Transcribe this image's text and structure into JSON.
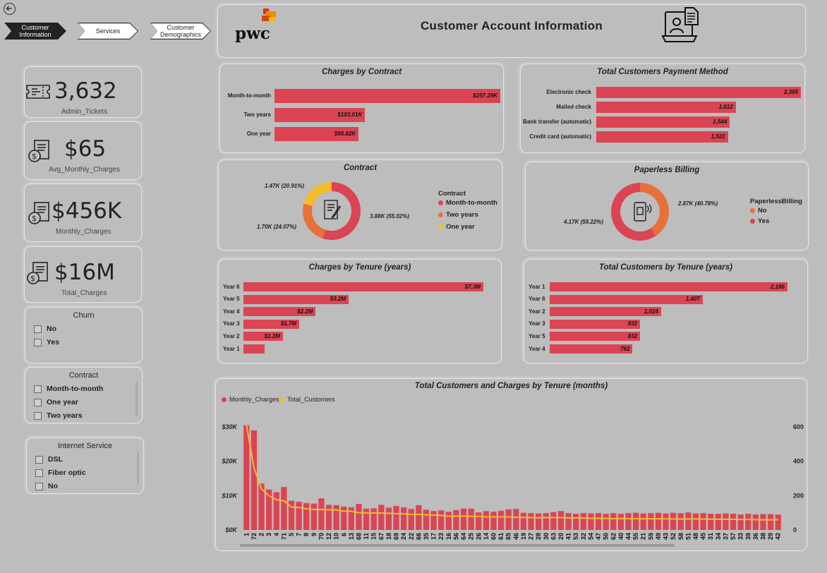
{
  "nav": {
    "tabs": [
      {
        "label_line1": "Customer",
        "label_line2": "Information"
      },
      {
        "label_line1": "Services",
        "label_line2": ""
      },
      {
        "label_line1": "Customer",
        "label_line2": "Demographics"
      }
    ]
  },
  "header": {
    "logo_text": "pwc",
    "title": "Customer Account Information"
  },
  "kpis": [
    {
      "value": "3,632",
      "label": "Admin_Tickets",
      "icon": "ticket-icon"
    },
    {
      "value": "$65",
      "label": "Avg_Monthly_Charges",
      "icon": "invoice-dollar-icon"
    },
    {
      "value": "$456K",
      "label": "Monthly_Charges",
      "icon": "invoice-dollar-icon"
    },
    {
      "value": "$16M",
      "label": "Total_Charges",
      "icon": "invoice-dollar-icon"
    }
  ],
  "slicers": {
    "churn": {
      "title": "Churn",
      "options": [
        "No",
        "Yes"
      ]
    },
    "contract": {
      "title": "Contract",
      "options": [
        "Month-to-month",
        "One year",
        "Two years"
      ]
    },
    "internet": {
      "title": "Internet Service",
      "options": [
        "DSL",
        "Fiber optic",
        "No"
      ]
    }
  },
  "colors": {
    "accent": "#db4453",
    "orange": "#e8703a",
    "yellow": "#f5bc29",
    "background": "#bdbdbd"
  },
  "charts": {
    "charges_by_contract": {
      "title": "Charges by Contract",
      "chart_data": {
        "type": "bar",
        "categories": [
          "Month-to-month",
          "Two years",
          "One year"
        ],
        "values": [
          257.29,
          103.01,
          95.82
        ],
        "value_labels": [
          "$257.29K",
          "$103.01K",
          "$95.82K"
        ],
        "unit": "K"
      }
    },
    "payment_method": {
      "title": "Total Customers Payment Method",
      "chart_data": {
        "type": "bar",
        "categories": [
          "Electronic check",
          "Mailed check",
          "Bank transfer (automatic)",
          "Credit card (automatic)"
        ],
        "values": [
          2365,
          1612,
          1544,
          1522
        ],
        "value_labels": [
          "2,365",
          "1,612",
          "1,544",
          "1,522"
        ]
      }
    },
    "contract_donut": {
      "title": "Contract",
      "legend_title": "Contract",
      "chart_data": {
        "type": "pie",
        "categories": [
          "Month-to-month",
          "Two years",
          "One year"
        ],
        "values": [
          55.02,
          24.07,
          20.91
        ],
        "value_labels": [
          "3.88K (55.02%)",
          "1.70K (24.07%)",
          "1.47K (20.91%)"
        ]
      }
    },
    "paperless_donut": {
      "title": "Paperless Billing",
      "legend_title": "PaperlessBilling",
      "chart_data": {
        "type": "pie",
        "categories": [
          "No",
          "Yes"
        ],
        "values": [
          40.78,
          59.22
        ],
        "value_labels": [
          "2.87K (40.78%)",
          "4.17K (59.22%)"
        ]
      }
    },
    "charges_by_tenure": {
      "title": "Charges by Tenure (years)",
      "chart_data": {
        "type": "bar",
        "categories": [
          "Year 6",
          "Year 5",
          "Year 4",
          "Year 3",
          "Year 2",
          "Year 1"
        ],
        "values": [
          7.3,
          3.2,
          2.2,
          1.7,
          1.2,
          0.65
        ],
        "value_labels": [
          "$7.3M",
          "$3.2M",
          "$2.2M",
          "$1.7M",
          "$1.2M",
          ""
        ],
        "unit": "M"
      }
    },
    "customers_by_tenure": {
      "title": "Total Customers by Tenure (years)",
      "chart_data": {
        "type": "bar",
        "categories": [
          "Year 1",
          "Year 6",
          "Year 2",
          "Year 3",
          "Year 5",
          "Year 4"
        ],
        "values": [
          2186,
          1407,
          1024,
          832,
          832,
          762
        ],
        "value_labels": [
          "2,186",
          "1,407",
          "1,024",
          "832",
          "832",
          "762"
        ]
      }
    },
    "tenure_months": {
      "title": "Total Customers and Charges by Tenure (months)",
      "chart_data": {
        "type": "bar",
        "categories": [
          "1",
          "72",
          "2",
          "3",
          "4",
          "71",
          "5",
          "7",
          "8",
          "9",
          "70",
          "12",
          "10",
          "6",
          "13",
          "68",
          "11",
          "15",
          "67",
          "18",
          "69",
          "24",
          "22",
          "66",
          "35",
          "17",
          "23",
          "16",
          "56",
          "64",
          "25",
          "26",
          "14",
          "60",
          "61",
          "65",
          "46",
          "19",
          "27",
          "28",
          "30",
          "63",
          "20",
          "41",
          "53",
          "32",
          "54",
          "47",
          "50",
          "62",
          "40",
          "44",
          "55",
          "21",
          "59",
          "49",
          "43",
          "52",
          "58",
          "51",
          "48",
          "45",
          "31",
          "34",
          "37",
          "57",
          "33",
          "39",
          "36",
          "38",
          "29",
          "42"
        ],
        "series": [
          {
            "name": "Monthly_Charges",
            "axis": "left",
            "values": [
              30500,
              29000,
              13500,
              11800,
              11000,
              12500,
              8500,
              8200,
              7800,
              7700,
              9200,
              7300,
              7200,
              6800,
              6600,
              7600,
              6200,
              6300,
              7300,
              6500,
              7000,
              6600,
              6100,
              7200,
              5900,
              5500,
              5700,
              5300,
              5800,
              6200,
              6200,
              5100,
              5500,
              5300,
              5600,
              6000,
              6100,
              5000,
              4900,
              4800,
              4900,
              5200,
              5500,
              4900,
              4700,
              4900,
              4800,
              4900,
              4700,
              4900,
              4700,
              4900,
              5000,
              4800,
              4900,
              5000,
              4800,
              5000,
              4900,
              5100,
              4800,
              4900,
              4700,
              4700,
              4800,
              4700,
              4500,
              4700,
              4500,
              4600,
              4600,
              4500
            ]
          },
          {
            "name": "Total_Customers",
            "axis": "right",
            "values": [
              613,
              362,
              238,
              200,
              176,
              170,
              133,
              131,
              123,
              119,
              119,
              117,
              116,
              110,
              109,
              100,
              99,
              99,
              98,
              97,
              95,
              94,
              90,
              91,
              88,
              87,
              85,
              80,
              80,
              80,
              79,
              79,
              76,
              76,
              76,
              76,
              74,
              73,
              72,
              71,
              72,
              72,
              73,
              70,
              70,
              69,
              68,
              68,
              67,
              66,
              67,
              66,
              66,
              65,
              65,
              65,
              65,
              64,
              63,
              64,
              64,
              63,
              63,
              62,
              62,
              62,
              61,
              61,
              60,
              59,
              59,
              59
            ]
          }
        ],
        "y_left": {
          "ticks": [
            "$0K",
            "$10K",
            "$20K",
            "$30K"
          ],
          "max": 30000
        },
        "y_right": {
          "ticks": [
            "0",
            "200",
            "400",
            "600"
          ],
          "max": 600
        },
        "legend": [
          "Monthly_Charges",
          "Total_Customers"
        ]
      }
    }
  }
}
